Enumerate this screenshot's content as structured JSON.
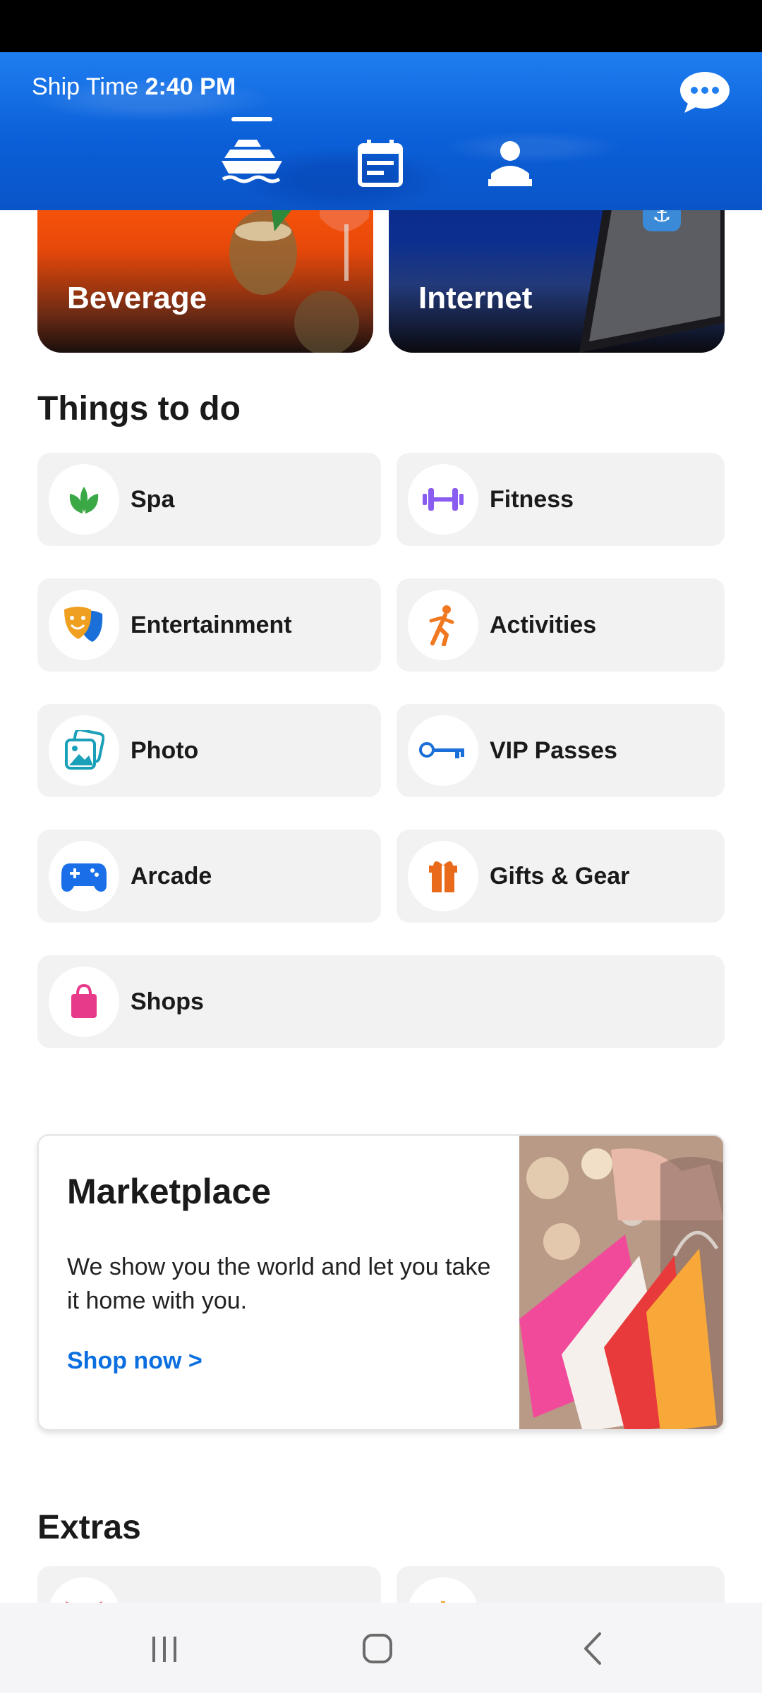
{
  "header": {
    "ship_time_label": "Ship Time",
    "ship_time_value": "2:40 PM",
    "nav": [
      {
        "id": "ship",
        "icon": "ship-icon",
        "active": true
      },
      {
        "id": "calendar",
        "icon": "calendar-icon",
        "active": false
      },
      {
        "id": "profile",
        "icon": "profile-icon",
        "active": false
      }
    ],
    "chat_icon": "chat-bubble-icon"
  },
  "promos": {
    "beverage_label": "Beverage",
    "internet_label": "Internet"
  },
  "things_to_do": {
    "title": "Things to do",
    "items": [
      {
        "label": "Spa",
        "icon": "lotus-icon",
        "color": "#3aa845"
      },
      {
        "label": "Fitness",
        "icon": "dumbbell-icon",
        "color": "#8a5cf0"
      },
      {
        "label": "Entertainment",
        "icon": "theater-masks-icon",
        "color": "#f0a020"
      },
      {
        "label": "Activities",
        "icon": "running-person-icon",
        "color": "#f07820"
      },
      {
        "label": "Photo",
        "icon": "photo-icon",
        "color": "#1aa0b8"
      },
      {
        "label": "VIP Passes",
        "icon": "key-icon",
        "color": "#1a70d8"
      },
      {
        "label": "Arcade",
        "icon": "gamepad-icon",
        "color": "#1a6fe8"
      },
      {
        "label": "Gifts & Gear",
        "icon": "gift-icon",
        "color": "#e86a1a"
      },
      {
        "label": "Shops",
        "icon": "shopping-bag-icon",
        "color": "#e83a8a"
      }
    ]
  },
  "marketplace": {
    "title": "Marketplace",
    "description": "We show you the world and let you take it home with you.",
    "link": "Shop now >"
  },
  "extras": {
    "title": "Extras"
  },
  "colors": {
    "header_blue": "#0b5fd8",
    "link_blue": "#0b6fe0",
    "tile_bg": "#f2f2f2"
  }
}
